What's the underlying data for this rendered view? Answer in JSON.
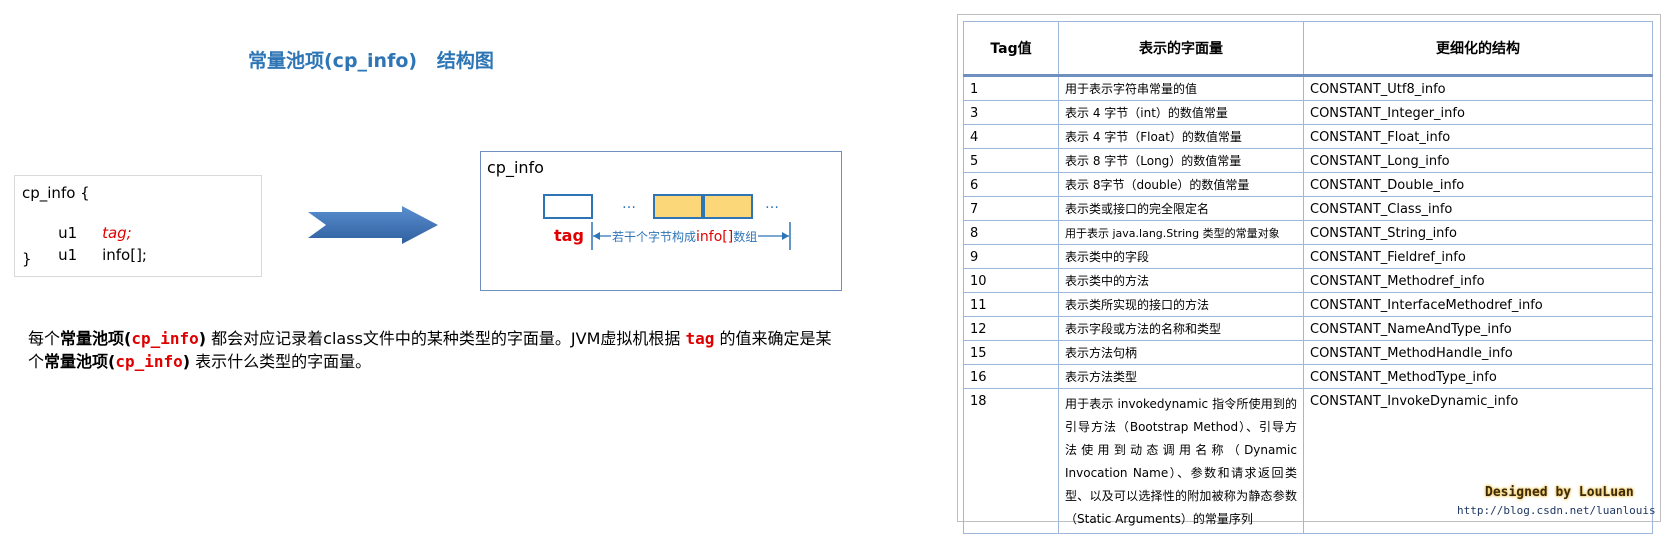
{
  "title": "常量池项(cp_info)   结构图",
  "code": {
    "line1": "cp_info {",
    "line2_type": "u1",
    "line2_name": "tag;",
    "line3_type": "u1",
    "line3_name": "info[];",
    "line4": "}"
  },
  "diagram": {
    "title": "cp_info",
    "dots1": "…",
    "dots2": "…",
    "tag_label": "tag",
    "bracket_prefix": "若干个字节构成",
    "bracket_highlight": "info[]",
    "bracket_suffix": "数组"
  },
  "description": {
    "p1_a": "每个",
    "p1_b": "常量池项(",
    "p1_c": "cp_info",
    "p1_d": ")",
    "p1_e": " 都会对应记录着class文件中的某种类型的字面量。JVM虚拟机根据 ",
    "p1_f": "tag",
    "p1_g": " 的值来确定是某个",
    "p1_h": "常量池项(",
    "p1_i": "cp_info",
    "p1_j": ")",
    "p1_k": " 表示什么类型的字面量。"
  },
  "table": {
    "headers": [
      "Tag值",
      "表示的字面量",
      "更细化的结构"
    ],
    "rows": [
      [
        "1",
        "用于表示字符串常量的值",
        "CONSTANT_Utf8_info"
      ],
      [
        "3",
        "表示 4 字节（int）的数值常量",
        "CONSTANT_Integer_info"
      ],
      [
        "4",
        "表示 4 字节（Float）的数值常量",
        "CONSTANT_Float_info"
      ],
      [
        "5",
        "表示 8 字节（Long）的数值常量",
        "CONSTANT_Long_info"
      ],
      [
        "6",
        "表示 8字节（double）的数值常量",
        "CONSTANT_Double_info"
      ],
      [
        "7",
        "表示类或接口的完全限定名",
        "CONSTANT_Class_info"
      ],
      [
        "8",
        "用于表示 java.lang.String 类型的常量对象",
        "CONSTANT_String_info"
      ],
      [
        "9",
        "表示类中的字段",
        "CONSTANT_Fieldref_info"
      ],
      [
        "10",
        "表示类中的方法",
        "CONSTANT_Methodref_info"
      ],
      [
        "11",
        "表示类所实现的接口的方法",
        "CONSTANT_InterfaceMethodref_info"
      ],
      [
        "12",
        "表示字段或方法的名称和类型",
        "CONSTANT_NameAndType_info"
      ],
      [
        "15",
        "表示方法句柄",
        "CONSTANT_MethodHandle_info"
      ],
      [
        "16",
        "表示方法类型",
        "CONSTANT_MethodType_info"
      ],
      [
        "18",
        "用于表示 invokedynamic 指令所使用到的引导方法（Bootstrap Method）、引导方法使用到动态调用名称（Dynamic Invocation Name）、参数和请求返回类型、以及可以选择性的附加被称为静态参数（Static  Arguments）的常量序列",
        "CONSTANT_InvokeDynamic_info"
      ]
    ]
  },
  "watermark": {
    "designed": "Designed by LouLuan",
    "blog": "http://blog.csdn.net/luanlouis"
  },
  "colors": {
    "title_blue": "#2e75b6",
    "tag_red": "#e00000",
    "cell_fill": "#fbd779",
    "arrow_blue": "#4a7ebb"
  }
}
